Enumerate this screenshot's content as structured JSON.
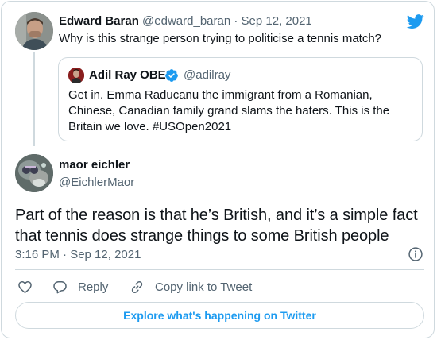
{
  "parent_tweet": {
    "author_name": "Edward Baran",
    "handle": "@edward_baran",
    "separator": "·",
    "date": "Sep 12, 2021",
    "text": "Why is this strange person trying to politicise a tennis match?"
  },
  "quoted_tweet": {
    "author_name": "Adil Ray OBE",
    "handle": "@adilray",
    "text": "Get in. Emma Raducanu the immigrant from a Romanian, Chinese, Canadian family grand slams the haters. This is the Britain we love. #USOpen2021"
  },
  "main_tweet": {
    "author_name": "maor eichler",
    "handle": "@EichlerMaor",
    "text": "Part of the reason is that he’s British, and it’s a simple fact that tennis does strange things to some British people",
    "timestamp": "3:16 PM · Sep 12, 2021"
  },
  "actions": {
    "reply_label": "Reply",
    "copy_link_label": "Copy link to Tweet"
  },
  "explore_label": "Explore what's happening on Twitter",
  "colors": {
    "accent": "#1d9bf0",
    "text": "#0f1419",
    "muted": "#536471",
    "border": "#cfd9de"
  },
  "icons": [
    "twitter-bird-icon",
    "verified-badge-icon",
    "info-icon",
    "heart-icon",
    "reply-icon",
    "link-icon"
  ]
}
